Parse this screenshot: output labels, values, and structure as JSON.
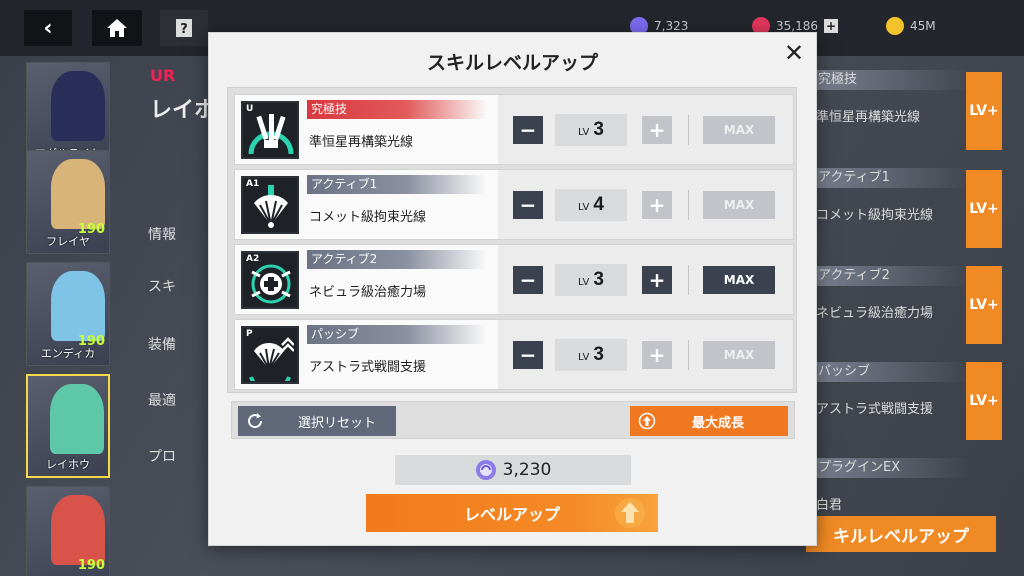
{
  "topbar": {
    "back_icon": "chevron-left-icon",
    "home_icon": "home-icon",
    "help_icon": "help-icon",
    "currency_1": "7,323",
    "currency_2": "35,186",
    "currency_3": "45M"
  },
  "roster": {
    "cards": [
      {
        "name": "マグルライト",
        "level": "",
        "color": "#2a2f5a"
      },
      {
        "name": "フレイヤ",
        "level": "190",
        "color": "#d9b479"
      },
      {
        "name": "エンディカ",
        "level": "190",
        "color": "#7fc4e6"
      },
      {
        "name": "レイホウ",
        "level": "",
        "color": "#5ec7a7"
      },
      {
        "name": "",
        "level": "190",
        "color": "#d8544a"
      }
    ]
  },
  "character": {
    "rarity": "UR",
    "name": "レイホ"
  },
  "side_menu": [
    "情報",
    "スキ",
    "装備",
    "最適",
    "プロ"
  ],
  "right_panel": {
    "rows": [
      {
        "tag": "究極技",
        "name": "準恒星再構築光線"
      },
      {
        "tag": "アクティブ1",
        "name": "コメット級拘束光線"
      },
      {
        "tag": "アクティブ2",
        "name": "ネビュラ級治癒力場"
      },
      {
        "tag": "パッシブ",
        "name": "アストラ式戦闘支援"
      },
      {
        "tag": "プラグインEX",
        "name": "白君"
      }
    ],
    "lvplus_label": "LV+",
    "bottom_button": "キルレベルアップ"
  },
  "dialog": {
    "title": "スキルレベルアップ",
    "close_icon": "close-icon",
    "skills": [
      {
        "slot": "U",
        "tag": "究極技",
        "tag_style": "red",
        "name": "準恒星再構築光線",
        "lv_prefix": "LV",
        "level": "3",
        "plus_enabled": false,
        "max_enabled": false
      },
      {
        "slot": "A1",
        "tag": "アクティブ1",
        "tag_style": "grey",
        "name": "コメット級拘束光線",
        "lv_prefix": "LV",
        "level": "4",
        "plus_enabled": false,
        "max_enabled": false
      },
      {
        "slot": "A2",
        "tag": "アクティブ2",
        "tag_style": "grey",
        "name": "ネビュラ級治癒力場",
        "lv_prefix": "LV",
        "level": "3",
        "plus_enabled": true,
        "max_enabled": true
      },
      {
        "slot": "P",
        "tag": "パッシブ",
        "tag_style": "grey",
        "name": "アストラ式戦闘支援",
        "lv_prefix": "LV",
        "level": "3",
        "plus_enabled": false,
        "max_enabled": false
      }
    ],
    "max_label": "MAX",
    "reset_label": "選択リセット",
    "reset_icon": "refresh-icon",
    "max_growth_label": "最大成長",
    "max_growth_icon": "upgrade-arrow-icon",
    "cost_icon": "skill-material-icon",
    "cost_value": "3,230",
    "levelup_label": "レベルアップ"
  },
  "colors": {
    "accent_orange": "#f27a1c",
    "dark_button": "#3c4150",
    "disabled_button": "#c2c4c9",
    "ultimate_red": "#d9383f"
  }
}
